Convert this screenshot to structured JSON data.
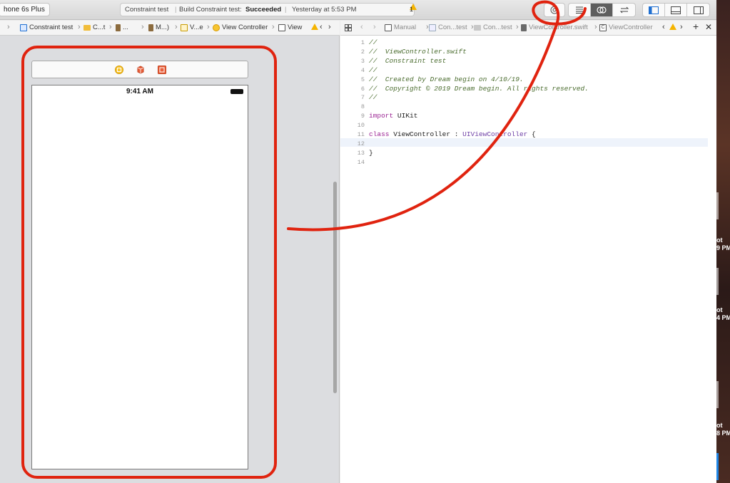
{
  "toolbar": {
    "device": "hone 6s Plus",
    "activity": {
      "project": "Constraint test",
      "status_prefix": "Build Constraint test:",
      "status": "Succeeded",
      "time": "Yesterday at 5:53 PM",
      "warnings": "1"
    }
  },
  "left_jumpbar": {
    "items": [
      "Constraint test",
      "C...t",
      "...",
      "M...)",
      "V...e",
      "View Controller",
      "View"
    ]
  },
  "right_jumpbar": {
    "items": [
      "Manual",
      "Con...test",
      "Con...test",
      "ViewController.swift",
      "ViewController"
    ]
  },
  "canvas": {
    "status_time": "9:41 AM"
  },
  "editor": {
    "lines": [
      {
        "num": "1",
        "text": "//"
      },
      {
        "num": "2",
        "text": "//  ViewController.swift"
      },
      {
        "num": "3",
        "text": "//  Constraint test"
      },
      {
        "num": "4",
        "text": "//"
      },
      {
        "num": "5",
        "text": "//  Created by Dream begin on 4/10/19."
      },
      {
        "num": "6",
        "text": "//  Copyright © 2019 Dream begin. All rights reserved."
      },
      {
        "num": "7",
        "text": "//"
      },
      {
        "num": "8",
        "text": ""
      },
      {
        "num": "9",
        "text": "import UIKit"
      },
      {
        "num": "10",
        "text": ""
      },
      {
        "num": "11",
        "text": "class ViewController : UIViewController {"
      },
      {
        "num": "12",
        "text": ""
      },
      {
        "num": "13",
        "text": "}"
      },
      {
        "num": "14",
        "text": ""
      }
    ]
  },
  "desktop": {
    "labels": [
      "ot\n9 PM",
      "ot\n4 PM",
      "ot\n8 PM"
    ]
  },
  "colors": {
    "annotation": "#e0230f",
    "comment": "#4a6c2e",
    "keyword": "#9b2393"
  }
}
